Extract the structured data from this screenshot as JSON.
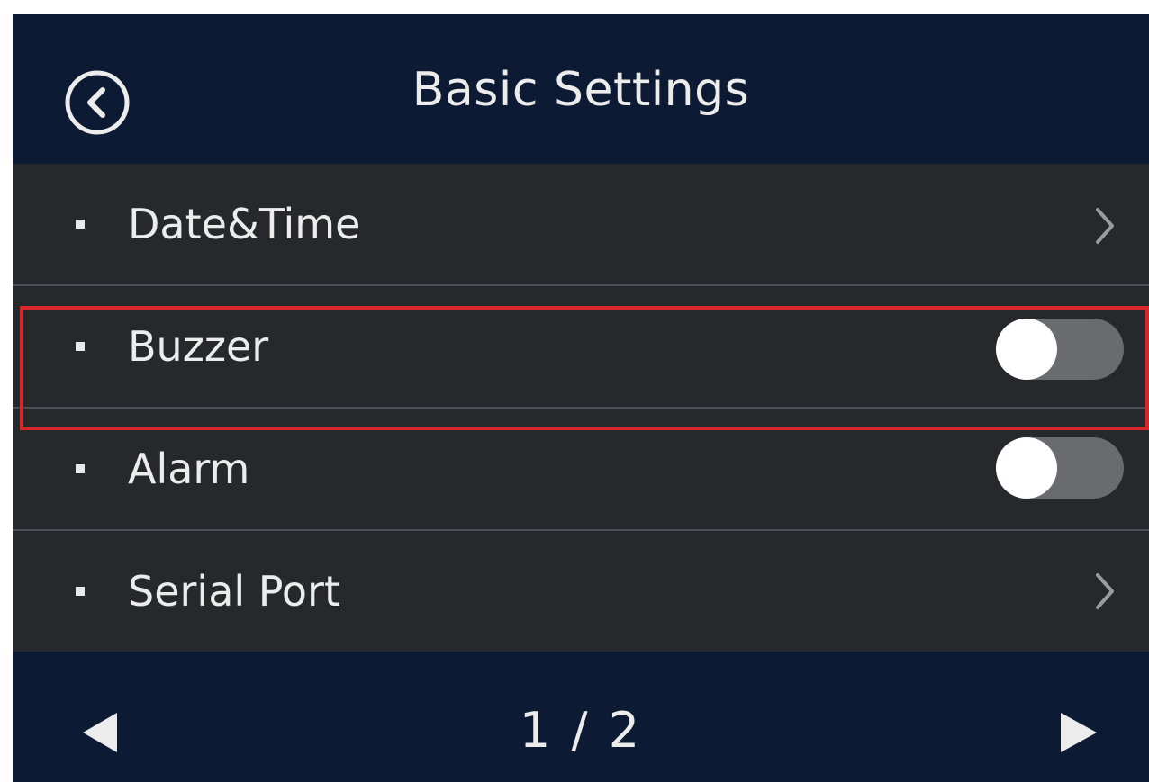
{
  "header": {
    "title": "Basic Settings",
    "back_icon": "circle-chevron-left-icon"
  },
  "settings": [
    {
      "label": "Date&Time",
      "control": "chevron-right-icon"
    },
    {
      "label": "Buzzer",
      "control": "toggle",
      "enabled": false
    },
    {
      "label": "Alarm",
      "control": "toggle",
      "enabled": false
    },
    {
      "label": "Serial Port",
      "control": "chevron-right-icon"
    }
  ],
  "highlighted_row": "Buzzer",
  "pagination": {
    "current_page": 1,
    "total_pages": 2,
    "text": "1 / 2",
    "prev_icon": "triangle-left-icon",
    "next_icon": "triangle-right-icon"
  },
  "colors": {
    "header_background": "#0c1b33",
    "row_background": "#27282b",
    "highlight_border": "#d9262b",
    "toggle_track_off": "#6a6b6e",
    "text": "#ececec"
  }
}
